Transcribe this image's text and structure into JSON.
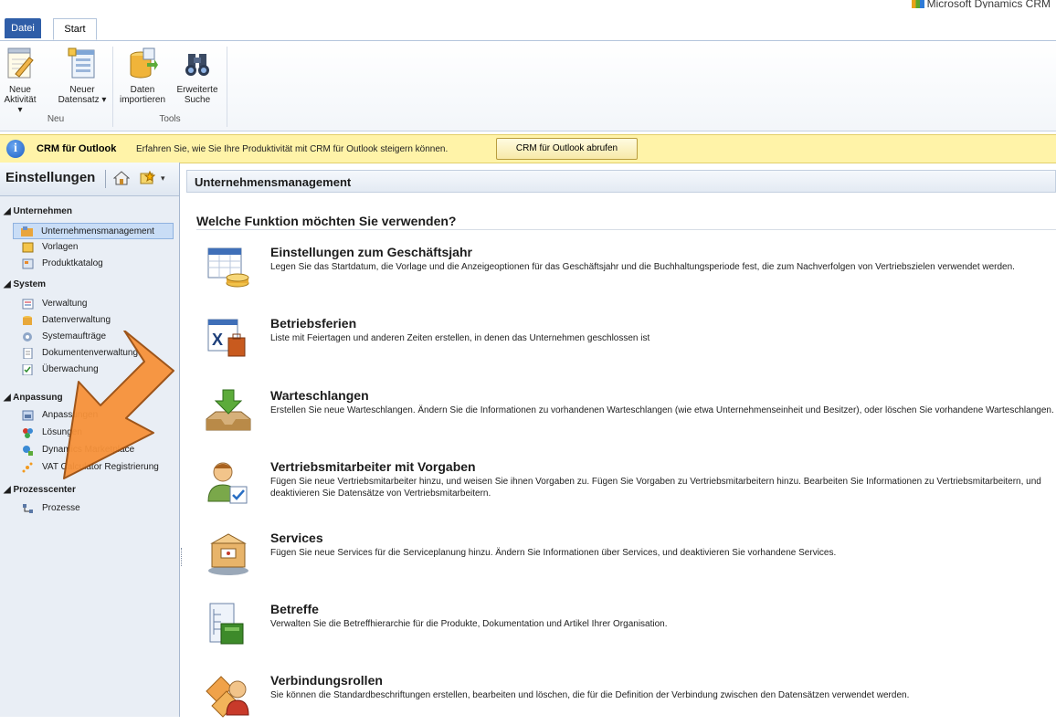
{
  "brand": {
    "text": "Microsoft Dynamics CRM"
  },
  "tabs": {
    "file": "Datei",
    "start": "Start"
  },
  "ribbon": {
    "buttons": [
      {
        "line1": "Neue",
        "line2": "Aktivität ▾",
        "icon": "notepad-pencil-icon"
      },
      {
        "line1": "Neuer",
        "line2": "Datensatz ▾",
        "icon": "form-document-icon"
      },
      {
        "line1": "Daten",
        "line2": "importieren",
        "icon": "database-import-icon"
      },
      {
        "line1": "Erweiterte",
        "line2": "Suche",
        "icon": "binoculars-icon"
      }
    ],
    "groups": {
      "neu": "Neu",
      "tools": "Tools"
    }
  },
  "notification": {
    "title": "CRM für Outlook",
    "text": "Erfahren Sie, wie Sie Ihre Produktivität mit CRM für Outlook steigern können.",
    "button": "CRM für Outlook abrufen"
  },
  "leftnav": {
    "title": "Einstellungen",
    "sections": [
      {
        "label": "◢ Unternehmen",
        "items": [
          {
            "label": "Unternehmensmanagement",
            "active": true
          },
          {
            "label": "Vorlagen"
          },
          {
            "label": "Produktkatalog"
          }
        ]
      },
      {
        "label": "◢ System",
        "items": [
          {
            "label": "Verwaltung"
          },
          {
            "label": "Datenverwaltung"
          },
          {
            "label": "Systemaufträge"
          },
          {
            "label": "Dokumentenverwaltung"
          },
          {
            "label": "Überwachung"
          }
        ]
      },
      {
        "label": "◢ Anpassung",
        "items": [
          {
            "label": "Anpassungen"
          },
          {
            "label": "Lösungen"
          },
          {
            "label": "Dynamics Marketplace"
          },
          {
            "label": "VAT Calculator Registrierung"
          }
        ]
      },
      {
        "label": "◢ Prozesscenter",
        "items": [
          {
            "label": "Prozesse"
          }
        ]
      }
    ]
  },
  "main": {
    "header": "Unternehmensmanagement",
    "question": "Welche Funktion möchten Sie verwenden?",
    "entries": [
      {
        "title": "Einstellungen zum Geschäftsjahr",
        "desc": "Legen Sie das Startdatum, die Vorlage und die Anzeigeoptionen für das Geschäftsjahr und die Buchhaltungsperiode fest, die zum Nachverfolgen von Vertriebszielen verwendet werden.",
        "icon": "calendar-coins-icon"
      },
      {
        "title": "Betriebsferien",
        "desc": "Liste mit Feiertagen und anderen Zeiten erstellen, in denen das Unternehmen geschlossen ist",
        "icon": "calendar-suitcase-icon"
      },
      {
        "title": "Warteschlangen",
        "desc": "Erstellen Sie neue Warteschlangen. Ändern Sie die Informationen zu vorhandenen Warteschlangen (wie etwa Unternehmenseinheit und Besitzer), oder löschen Sie vorhandene Warteschlangen.",
        "icon": "inbox-arrow-icon"
      },
      {
        "title": "Vertriebsmitarbeiter mit Vorgaben",
        "desc": "Fügen Sie neue Vertriebsmitarbeiter hinzu, und weisen Sie ihnen Vorgaben zu. Fügen Sie Vorgaben zu Vertriebsmitarbeitern hinzu. Bearbeiten Sie Informationen zu Vertriebsmitarbeitern, und deaktivieren Sie Datensätze von Vertriebsmitarbeitern.",
        "icon": "user-checkmark-icon"
      },
      {
        "title": "Services",
        "desc": "Fügen Sie neue Services für die Serviceplanung hinzu. Ändern Sie Informationen über Services, und deaktivieren Sie vorhandene Services.",
        "icon": "service-box-icon"
      },
      {
        "title": "Betreffe",
        "desc": "Verwalten Sie die Betreffhierarchie für die Produkte, Dokumentation und Artikel Ihrer Organisation.",
        "icon": "subject-tree-icon"
      },
      {
        "title": "Verbindungsrollen",
        "desc": "Sie können die Standardbeschriftungen erstellen, bearbeiten und löschen, die für die Definition der Verbindung zwischen den Datensätzen verwendet werden.",
        "icon": "connection-user-icon"
      }
    ]
  },
  "colors": {
    "accent": "#2f5ea8",
    "notification": "#fff3a8",
    "arrow": "#f7923a",
    "nav_bg": "#e9eef5"
  }
}
